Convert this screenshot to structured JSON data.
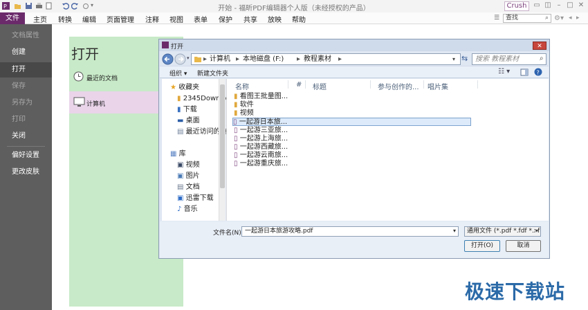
{
  "app": {
    "title": "开始 - 福昕PDF编辑器个人版（未经授权的产品）",
    "user_label": "Crush",
    "brand_color": "#6b2b6b"
  },
  "menubar": {
    "file": "文件",
    "items": [
      "主页",
      "转换",
      "编辑",
      "页面管理",
      "注释",
      "视图",
      "表单",
      "保护",
      "共享",
      "放映",
      "帮助"
    ],
    "search_placeholder": "查找"
  },
  "sidebar": {
    "items": [
      {
        "label": "文档属性",
        "state": "disabled"
      },
      {
        "label": "创建",
        "state": "normal"
      },
      {
        "label": "打开",
        "state": "selected"
      },
      {
        "label": "保存",
        "state": "disabled"
      },
      {
        "label": "另存为",
        "state": "disabled"
      },
      {
        "label": "打印",
        "state": "disabled"
      },
      {
        "label": "关闭",
        "state": "normal"
      },
      {
        "label": "偏好设置",
        "state": "normal"
      },
      {
        "label": "更改皮肤",
        "state": "normal"
      }
    ]
  },
  "open_page": {
    "title": "打开",
    "recent_label": "最近的文档",
    "computer_label": "计算机"
  },
  "dialog": {
    "title": "打开",
    "close_label": "✕",
    "breadcrumb": [
      "计算机",
      "本地磁盘 (F:)",
      "教程素材"
    ],
    "search_placeholder": "搜索 教程素材",
    "toolbar": {
      "organize": "组织 ▾",
      "new_folder": "新建文件夹"
    },
    "nav": {
      "favorites_header": "收藏夹",
      "favorites": [
        "2345Downlo",
        "下载",
        "桌面",
        "最近访问的位"
      ],
      "libraries_header": "库",
      "libraries": [
        "视频",
        "图片",
        "文档",
        "迅雷下载",
        "音乐"
      ]
    },
    "columns": [
      "名称",
      "#",
      "标题",
      "参与创作的...",
      "唱片集"
    ],
    "files": [
      {
        "name": "看图王批量图...",
        "type": "folder"
      },
      {
        "name": "软件",
        "type": "folder"
      },
      {
        "name": "视频",
        "type": "folder"
      },
      {
        "name": "一起游日本旅...",
        "type": "pdf",
        "selected": true
      },
      {
        "name": "一起游三亚旅...",
        "type": "pdf"
      },
      {
        "name": "一起游上海旅...",
        "type": "pdf"
      },
      {
        "name": "一起游西藏旅...",
        "type": "pdf"
      },
      {
        "name": "一起游云南旅...",
        "type": "pdf"
      },
      {
        "name": "一起游重庆旅...",
        "type": "pdf"
      }
    ],
    "filename_label": "文件名(N):",
    "filename_value": "一起游日本旅游攻略.pdf",
    "filetype_value": "通用文件 (*.pdf *.fdf *.xfdf *.x",
    "open_button": "打开(O)",
    "cancel_button": "取消"
  },
  "watermark": "极速下载站"
}
